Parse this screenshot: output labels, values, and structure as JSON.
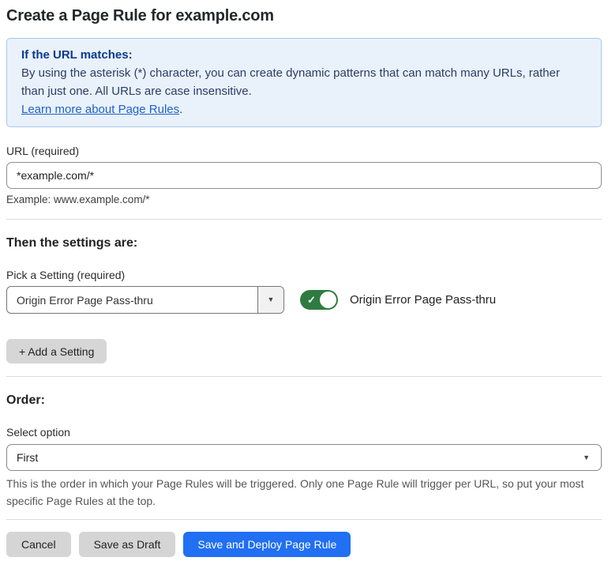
{
  "title": "Create a Page Rule for example.com",
  "info_box": {
    "heading": "If the URL matches:",
    "body": "By using the asterisk (*) character, you can create dynamic patterns that can match many URLs, rather than just one. All URLs are case insensitive.",
    "link": "Learn more about Page Rules",
    "link_suffix": "."
  },
  "url_field": {
    "label": "URL (required)",
    "value": "*example.com/*",
    "example": "Example: www.example.com/*"
  },
  "settings": {
    "heading": "Then the settings are:",
    "pick_label": "Pick a Setting (required)",
    "selected_setting": "Origin Error Page Pass-thru",
    "toggle_state": "on",
    "toggle_label": "Origin Error Page Pass-thru",
    "add_button_label": "+ Add a Setting"
  },
  "order": {
    "heading": "Order:",
    "select_label": "Select option",
    "selected_option": "First",
    "help": "This is the order in which your Page Rules will be triggered. Only one Page Rule will trigger per URL, so put your most specific Page Rules at the top."
  },
  "footer": {
    "cancel_label": "Cancel",
    "save_draft_label": "Save as Draft",
    "save_deploy_label": "Save and Deploy Page Rule"
  },
  "icons": {
    "dropdown_arrow": "▼",
    "select_arrow": "▼",
    "toggle_check": "✓"
  },
  "colors": {
    "info_bg": "#e9f1fb",
    "info_border": "#a7c7ec",
    "info_heading_text": "#0c3b8d",
    "info_body_text": "#2c3d66",
    "link": "#2063c9",
    "toggle_on": "#2e7b41",
    "primary_button": "#216ff2",
    "secondary_button": "#d5d5d5"
  }
}
